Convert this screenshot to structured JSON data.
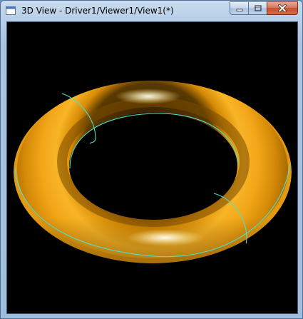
{
  "window": {
    "title": "3D View - Driver1/Viewer1/View1(*)",
    "icon": "3d-view-icon"
  },
  "caption_buttons": {
    "minimize_icon": "minimize-icon",
    "maximize_icon": "maximize-icon",
    "close_icon": "close-icon"
  },
  "viewport": {
    "background_color": "#000000",
    "object": "torus",
    "shading_color": "#f2a81c",
    "isoline_color": "#4fe0c8"
  }
}
